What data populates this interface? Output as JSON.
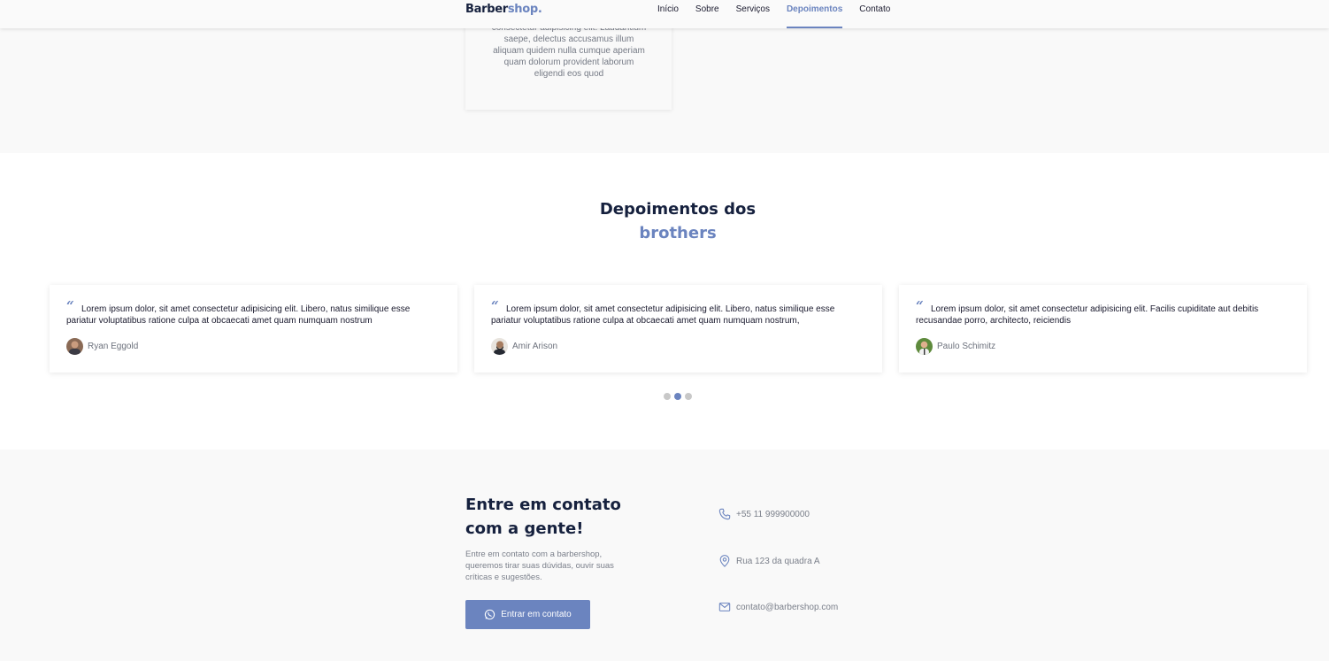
{
  "header": {
    "logo_main": "Barber",
    "logo_accent": "shop.",
    "nav": [
      "Início",
      "Sobre",
      "Serviços",
      "Depoimentos",
      "Contato"
    ],
    "active_nav": "Depoimentos",
    "accent_color": "#6b84bf"
  },
  "services": {
    "card_text": "consectetur adipisicing elit. Laudantium saepe, delectus accusamus illum aliquam quidem nulla cumque aperiam quam dolorum provident laborum eligendi eos quod"
  },
  "testimonials": {
    "title": "Depoimentos dos",
    "title_highlight": "brothers",
    "items": [
      {
        "text": "Lorem ipsum dolor, sit amet consectetur adipisicing elit. Libero, natus similique esse pariatur voluptatibus ratione culpa at obcaecati amet quam numquam nostrum",
        "name": "Ryan Eggold",
        "avatar": "avatar-photo"
      },
      {
        "text": "Lorem ipsum dolor, sit amet consectetur adipisicing elit. Libero, natus similique esse pariatur voluptatibus ratione culpa at obcaecati amet quam numquam nostrum,",
        "name": "Amir Arison",
        "avatar": "avatar-photo"
      },
      {
        "text": "Lorem ipsum dolor, sit amet consectetur adipisicing elit. Facilis cupiditate aut debitis recusandae porro, architecto, reiciendis",
        "name": "Paulo Schimitz",
        "avatar": "avatar-photo"
      }
    ],
    "pagination": {
      "pages": 3,
      "active": 2
    }
  },
  "contact": {
    "title": "Entre em contato com a gente!",
    "description": "Entre em contato com a barbershop, queremos tirar suas dúvidas, ouvir suas críticas e sugestões.",
    "button_label": "Entrar em contato",
    "phone": "+55 11 999900000",
    "address": "Rua 123 da quadra A",
    "email": "contato@barbershop.com"
  }
}
